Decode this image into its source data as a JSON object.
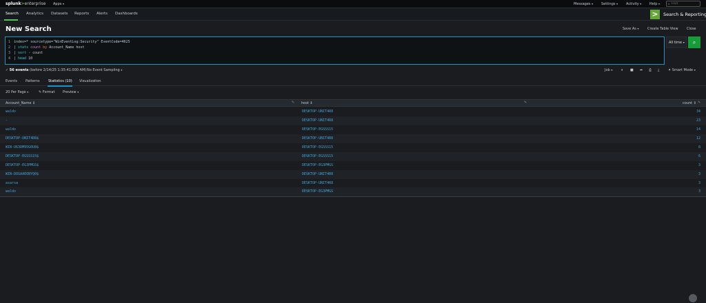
{
  "topbar": {
    "logo": {
      "splunk": "splunk",
      "gt": ">",
      "enterprise": "enterprise"
    },
    "apps_label": "Apps",
    "right_menu": [
      {
        "label": "Messages"
      },
      {
        "label": "Settings"
      },
      {
        "label": "Activity"
      },
      {
        "label": "Help"
      }
    ],
    "find_placeholder": "Find"
  },
  "appbar": {
    "tabs": [
      {
        "label": "Search",
        "active": true
      },
      {
        "label": "Analytics"
      },
      {
        "label": "Datasets"
      },
      {
        "label": "Reports"
      },
      {
        "label": "Alerts"
      },
      {
        "label": "Dashboards"
      }
    ],
    "app_icon": ">",
    "app_name": "Search & Reporting"
  },
  "page": {
    "title": "New Search",
    "actions": [
      {
        "label": "Save As"
      },
      {
        "label": "Create Table View"
      },
      {
        "label": "Close"
      }
    ]
  },
  "query": {
    "lines": [
      {
        "num": "1",
        "parts": [
          "index=* sourcetype=\"WinEventLog:Security\" EventCode=4625"
        ]
      },
      {
        "num": "2",
        "parts": [
          "| ",
          "stats ",
          "count ",
          "by ",
          "Account_Name host"
        ]
      },
      {
        "num": "3",
        "parts": [
          "| ",
          "sort ",
          "- count"
        ]
      },
      {
        "num": "4",
        "parts": [
          "| ",
          "head ",
          "10"
        ]
      }
    ],
    "time_range": "All time",
    "search_icon": "search-icon"
  },
  "status": {
    "events_count": "56 events",
    "events_detail": "(before 2/14/25 1:35:41.000 AM)",
    "sampling": "No Event Sampling",
    "job": "Job",
    "mode": "Smart Mode"
  },
  "tabs": [
    {
      "label": "Events"
    },
    {
      "label": "Patterns"
    },
    {
      "label": "Statistics (10)",
      "active": true
    },
    {
      "label": "Visualization"
    }
  ],
  "tools": {
    "per_page": "20 Per Page",
    "format": "Format",
    "preview": "Preview"
  },
  "table": {
    "headers": [
      "Account_Name",
      "host",
      "count"
    ],
    "rows": [
      {
        "account": "waldo",
        "host": "DESKTOP-UNIT4R8",
        "count": "34"
      },
      {
        "account": "-",
        "host": "DESKTOP-UNIT4R8",
        "count": "23"
      },
      {
        "account": "waldo",
        "host": "DESKTOP-EGSSS15",
        "count": "14"
      },
      {
        "account": "DESKTOP-UNIT4R8$",
        "host": "DESKTOP-UNIT4R8",
        "count": "12"
      },
      {
        "account": "WIN-U63DM95G0U8$",
        "host": "DESKTOP-EGSSS15",
        "count": "8"
      },
      {
        "account": "DESKTOP-EGSSS15$",
        "host": "DESKTOP-EGSSS15",
        "count": "6"
      },
      {
        "account": "DESKTOP-EG3PMGS$",
        "host": "DESKTOP-EG3PMGS",
        "count": "3"
      },
      {
        "account": "WIN-DOSAAEOBYQ0$",
        "host": "DESKTOP-UNIT4R8",
        "count": "3"
      },
      {
        "account": "asarsa",
        "host": "DESKTOP-UNIT4R8",
        "count": "3"
      },
      {
        "account": "waldo",
        "host": "DESKTOP-EG3PMGS",
        "count": "3"
      }
    ]
  },
  "colors": {
    "accent": "#65a637",
    "link": "#45a2d8",
    "focus": "#1e93c6",
    "go_button": "#1a9b3a"
  }
}
